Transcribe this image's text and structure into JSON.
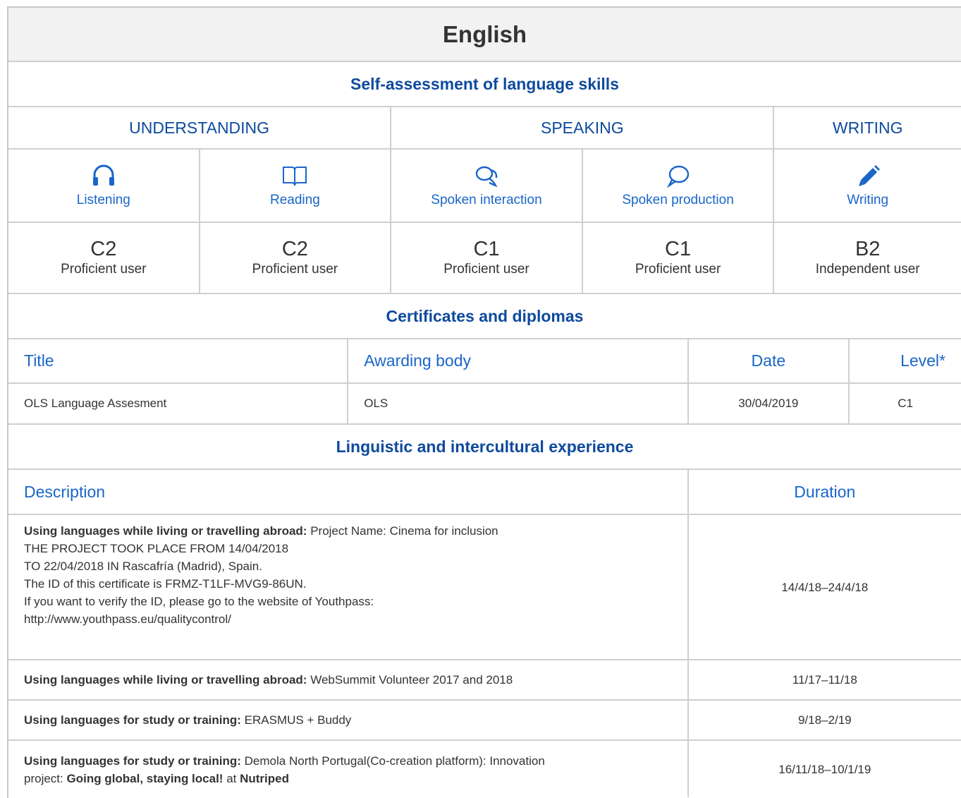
{
  "language": "English",
  "self_assessment": {
    "heading": "Self-assessment of language skills",
    "categories": [
      "UNDERSTANDING",
      "SPEAKING",
      "WRITING"
    ],
    "skills": [
      {
        "label": "Listening",
        "icon": "headphones-icon",
        "level": "C2",
        "level_desc": "Proficient user"
      },
      {
        "label": "Reading",
        "icon": "book-icon",
        "level": "C2",
        "level_desc": "Proficient user"
      },
      {
        "label": "Spoken interaction",
        "icon": "chat-bubbles-icon",
        "level": "C1",
        "level_desc": "Proficient user"
      },
      {
        "label": "Spoken production",
        "icon": "speech-bubble-icon",
        "level": "C1",
        "level_desc": "Proficient user"
      },
      {
        "label": "Writing",
        "icon": "pencil-icon",
        "level": "B2",
        "level_desc": "Independent user"
      }
    ]
  },
  "certificates": {
    "heading": "Certificates and diplomas",
    "columns": [
      "Title",
      "Awarding body",
      "Date",
      "Level*"
    ],
    "rows": [
      {
        "title": "OLS Language Assesment",
        "awarding_body": "OLS",
        "date": "30/04/2019",
        "level": "C1"
      }
    ]
  },
  "experience": {
    "heading": "Linguistic and intercultural experience",
    "columns": [
      "Description",
      "Duration"
    ],
    "rows": [
      {
        "type": "Using languages while living or travelling abroad:",
        "text_lines": [
          "Project Name:  Cinema for inclusion",
          "THE PROJECT TOOK PLACE FROM 14/04/2018",
          "TO 22/04/2018 IN Rascafría (Madrid), Spain.",
          "The ID of this certificate is FRMZ-T1LF-MVG9-86UN.",
          "If you want to verify the ID, please go to the website of Youthpass:",
          "http://www.youthpass.eu/qualitycontrol/"
        ],
        "duration": "14/4/18–24/4/18"
      },
      {
        "type": "Using languages while living or travelling abroad:",
        "text": "WebSummit Volunteer 2017 and 2018",
        "duration": "11/17–11/18"
      },
      {
        "type": "Using languages for study or training:",
        "text": "ERASMUS + Buddy",
        "duration": "9/18–2/19"
      },
      {
        "type": "Using languages for study or training:",
        "text_a": "Demola North Portugal(Co-creation platform): Innovation",
        "text_b": "project:",
        "bold_b": "Going global, staying local!",
        "text_c": "at",
        "bold_c": "Nutriped",
        "duration": "16/11/18–10/1/19"
      }
    ]
  },
  "colors": {
    "heading_blue": "#0e4a9e",
    "link_blue": "#1a66c9",
    "border": "#cfcfcf",
    "title_bg": "#f2f2f2"
  }
}
